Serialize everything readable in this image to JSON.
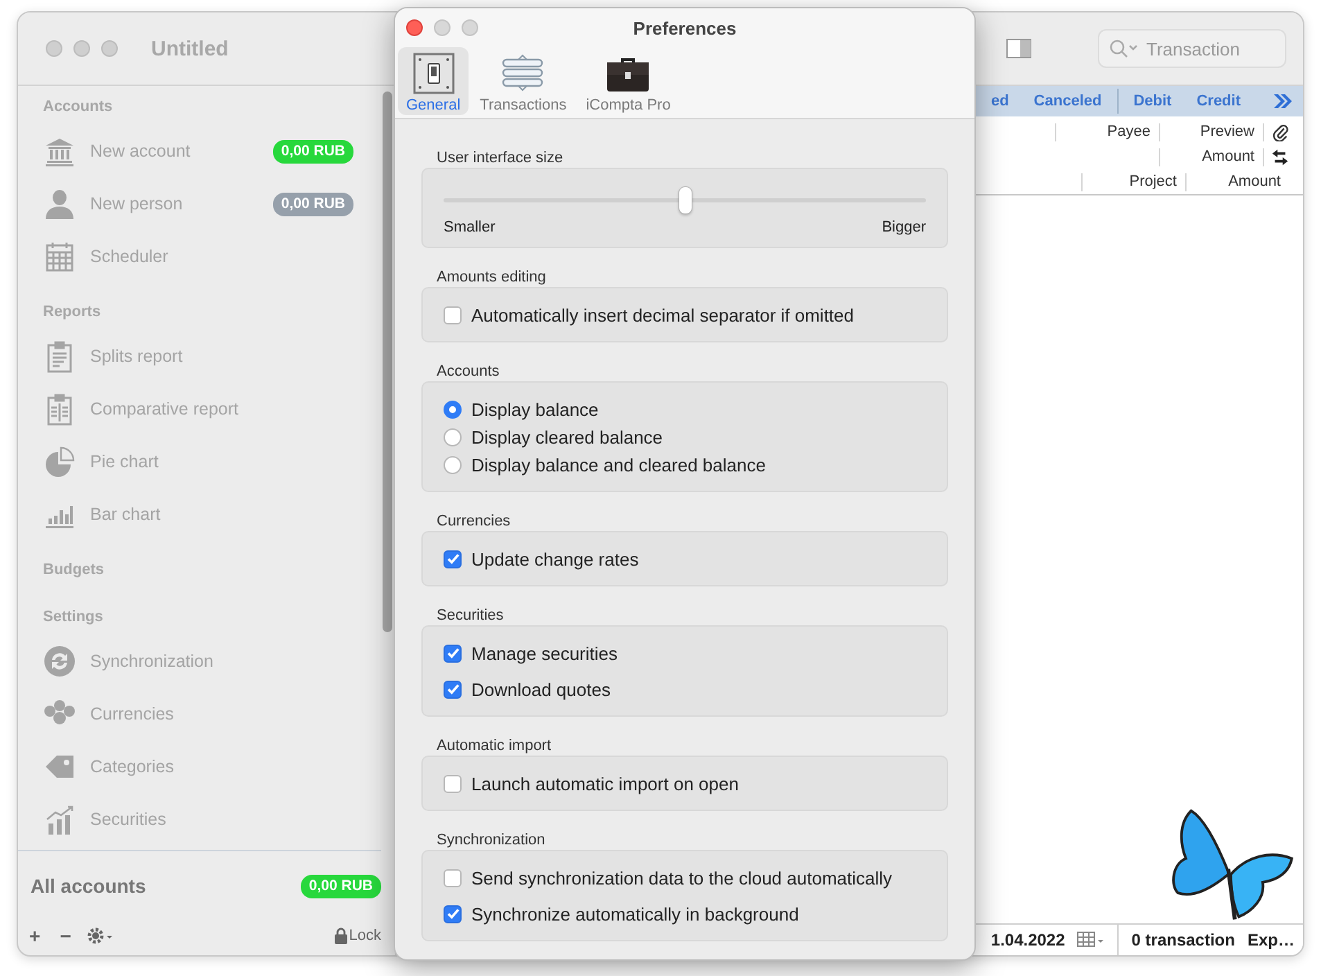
{
  "main_window": {
    "title": "Untitled",
    "search": {
      "placeholder": "Transaction"
    },
    "sidebar": {
      "sections": [
        {
          "title": "Accounts",
          "items": [
            {
              "label": "New account",
              "badge": "0,00 RUB",
              "color": "#27d83c"
            },
            {
              "label": "New person",
              "badge": "0,00 RUB",
              "color": "#96a0ab"
            },
            {
              "label": "Scheduler"
            }
          ]
        },
        {
          "title": "Reports",
          "items": [
            {
              "label": "Splits report"
            },
            {
              "label": "Comparative report"
            },
            {
              "label": "Pie chart"
            },
            {
              "label": "Bar chart"
            }
          ]
        },
        {
          "title": "Budgets"
        },
        {
          "title": "Settings",
          "items": [
            {
              "label": "Synchronization"
            },
            {
              "label": "Currencies"
            },
            {
              "label": "Categories"
            },
            {
              "label": "Securities"
            }
          ]
        }
      ],
      "total": {
        "label": "All accounts",
        "badge": "0,00 RUB",
        "color": "#27d83c"
      },
      "footer": {
        "buttons": [
          "+",
          "−"
        ],
        "lock": "Lock"
      }
    },
    "filter_groups": [
      [
        "ed",
        "Canceled"
      ],
      [
        "Debit",
        "Credit"
      ]
    ],
    "header_rows": [
      [
        "Payee",
        "Preview"
      ],
      [
        "Amount"
      ],
      [
        "Project",
        "Amount"
      ]
    ],
    "status_bar": {
      "date": "1.04.2022",
      "count": "0 transaction",
      "column_3": "Exp…"
    }
  },
  "preferences": {
    "title": "Preferences",
    "tabs": [
      {
        "label": "General",
        "selected": true
      },
      {
        "label": "Transactions",
        "selected": false
      },
      {
        "label": "iCompta Pro",
        "selected": false
      }
    ],
    "groups": [
      {
        "title": "User interface size",
        "controls": [
          {
            "kind": "slider",
            "level": 0.5,
            "min_label": "Smaller",
            "max_label": "Bigger"
          }
        ]
      },
      {
        "title": "Amounts editing",
        "controls": [
          {
            "kind": "checkbox",
            "label": "Automatically insert decimal separator if omitted",
            "checked": false
          }
        ]
      },
      {
        "title": "Accounts",
        "controls": [
          {
            "kind": "radio",
            "label": "Display balance",
            "selected": true
          },
          {
            "kind": "radio",
            "label": "Display cleared balance",
            "selected": false
          },
          {
            "kind": "radio",
            "label": "Display balance and cleared balance",
            "selected": false
          }
        ]
      },
      {
        "title": "Currencies",
        "controls": [
          {
            "kind": "checkbox",
            "label": "Update change rates",
            "checked": true
          }
        ]
      },
      {
        "title": "Securities",
        "controls": [
          {
            "kind": "checkbox",
            "label": "Manage securities",
            "checked": true
          },
          {
            "kind": "checkbox",
            "label": "Download quotes",
            "checked": true
          }
        ]
      },
      {
        "title": "Automatic import",
        "controls": [
          {
            "kind": "checkbox",
            "label": "Launch automatic import on open",
            "checked": false
          }
        ]
      },
      {
        "title": "Synchronization",
        "controls": [
          {
            "kind": "checkbox",
            "label": "Send synchronization data to the cloud automatically",
            "checked": false
          },
          {
            "kind": "checkbox",
            "label": "Synchronize automatically in background",
            "checked": true
          }
        ]
      }
    ]
  }
}
